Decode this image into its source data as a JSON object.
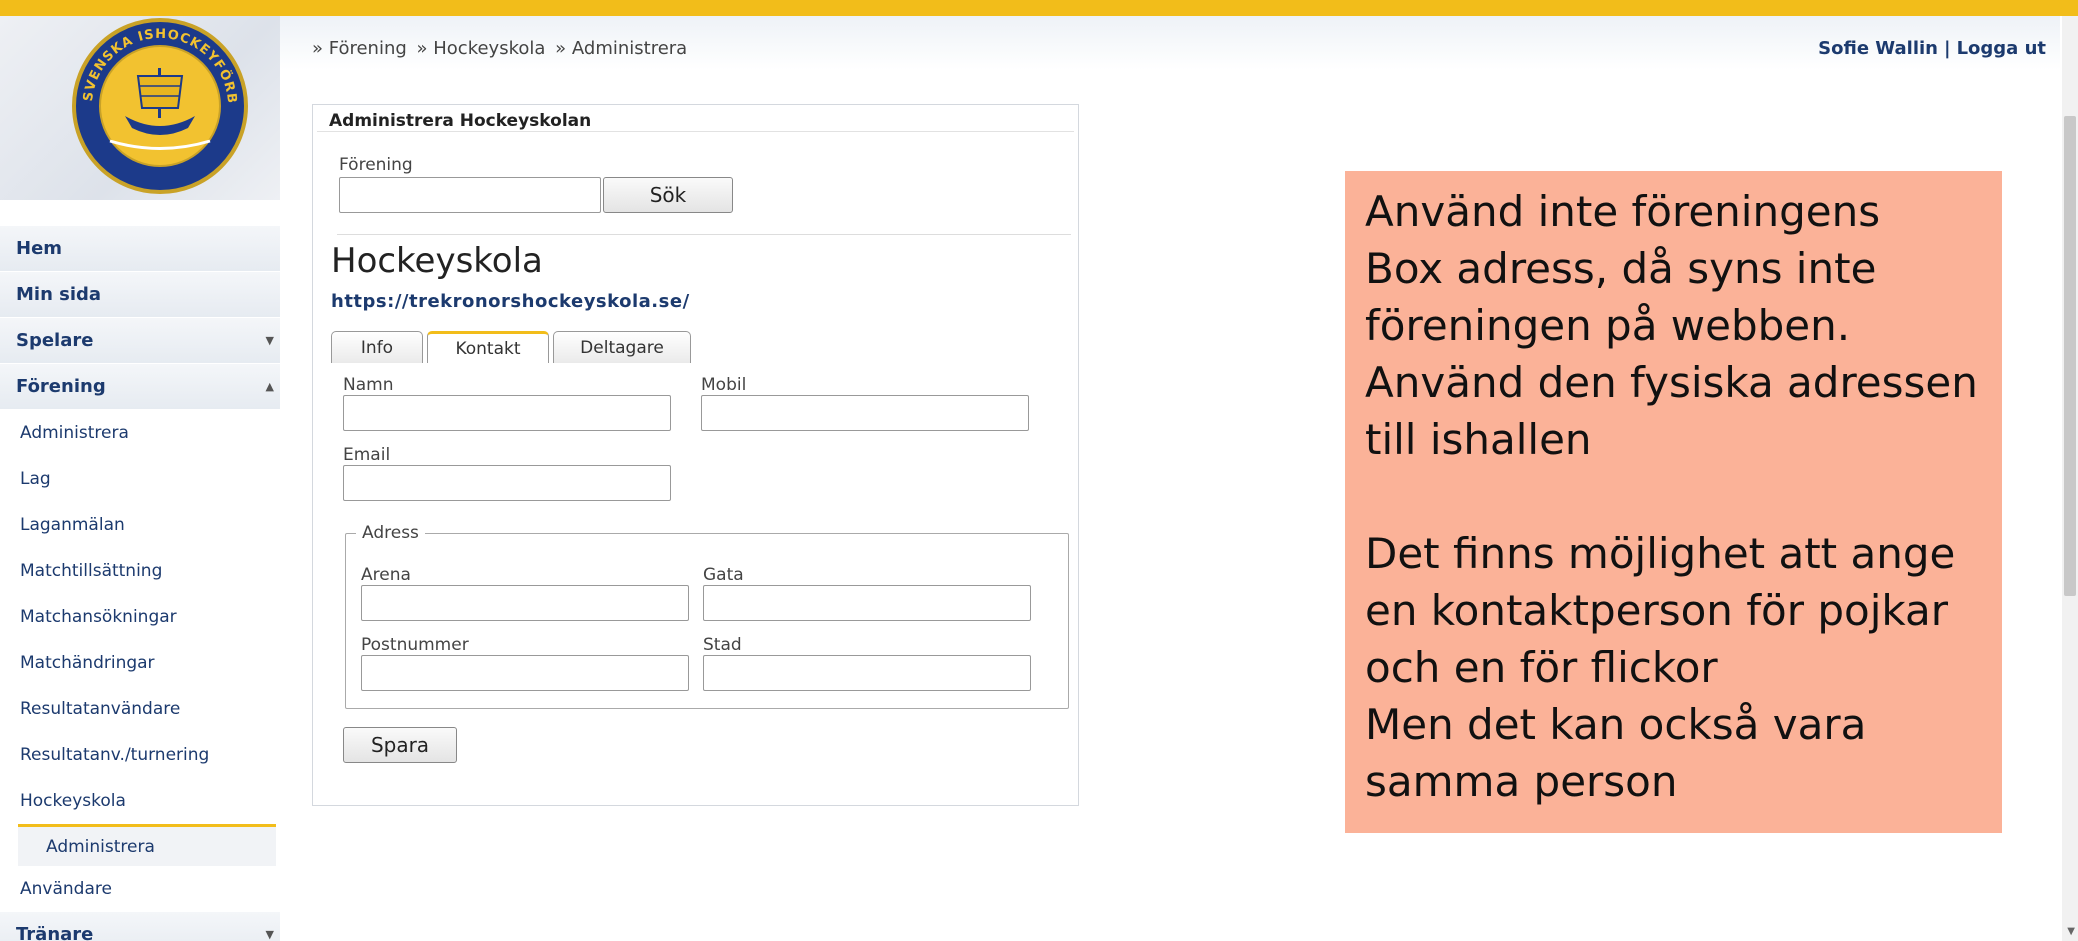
{
  "header": {
    "breadcrumb": [
      "» Förening",
      "» Hockeyskola",
      "» Administrera"
    ],
    "user_name": "Sofie Wallin",
    "separator": "|",
    "logout": "Logga ut"
  },
  "logo": {
    "icon": "swedish-ice-hockey-association-logo",
    "text": "SVENSKA ISHOCKEYFÖRBUNDET"
  },
  "sidebar": {
    "main": [
      {
        "label": "Hem"
      },
      {
        "label": "Min sida"
      },
      {
        "label": "Spelare",
        "arrow": "▼"
      },
      {
        "label": "Förening",
        "arrow": "▲"
      }
    ],
    "sub": [
      "Administrera",
      "Lag",
      "Laganmälan",
      "Matchtillsättning",
      "Matchansökningar",
      "Matchändringar",
      "Resultatanvändare",
      "Resultatanv./turnering",
      "Hockeyskola"
    ],
    "active_sub": "Administrera",
    "after": "Användare",
    "last_main": {
      "label": "Tränare",
      "arrow": "▼"
    }
  },
  "panel": {
    "title": "Administrera Hockeyskolan",
    "search_label": "Förening",
    "search_value": "",
    "search_button": "Sök",
    "heading": "Hockeyskola",
    "url": "https://trekronorshockeyskola.se/",
    "tabs": [
      "Info",
      "Kontakt",
      "Deltagare"
    ],
    "active_tab": "Kontakt",
    "labels": {
      "name": "Namn",
      "mobile": "Mobil",
      "email": "Email",
      "address": "Adress",
      "arena": "Arena",
      "street": "Gata",
      "postcode": "Postnummer",
      "city": "Stad"
    },
    "save_button": "Spara"
  },
  "note": {
    "lines": [
      "Använd inte föreningens",
      "Box adress, då syns inte",
      "föreningen på webben.",
      "Använd den fysiska adressen",
      "till ishallen",
      "",
      "Det finns möjlighet att ange",
      "en kontaktperson för pojkar",
      "och en för flickor",
      "Men det kan också vara",
      "samma person"
    ],
    "color": "#fbb298"
  },
  "colors": {
    "accent": "#f2bd1a",
    "link": "#1c3a6e"
  }
}
